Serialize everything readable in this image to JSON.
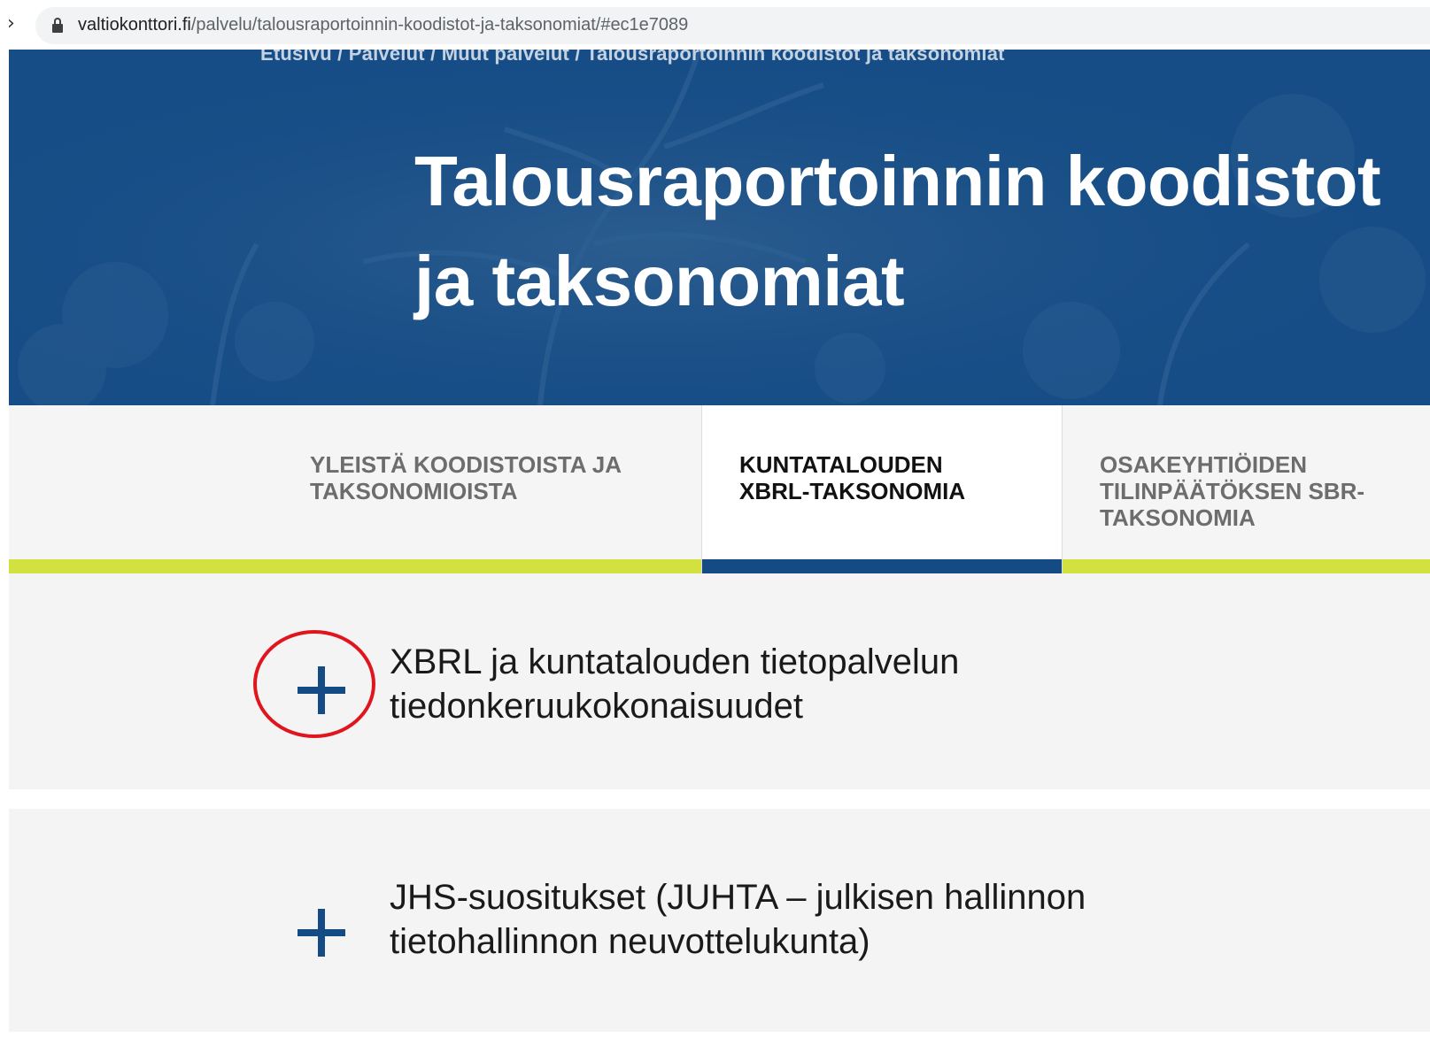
{
  "browser": {
    "url_domain": "valtiokonttori.fi",
    "url_path": "/palvelu/talousraportoinnin-koodistot-ja-taksonomiat/#ec1e7089"
  },
  "hero": {
    "breadcrumb": "Etusivu / Palvelut / Muut palvelut / Talousraportoinnin koodistot ja taksonomiat",
    "title": "Talousraportoinnin koodistot ja taksonomiat"
  },
  "tabs": [
    {
      "lines": [
        "YLEISTÄ KOODISTOISTA JA",
        "TAKSONOMIOISTA"
      ],
      "active": false
    },
    {
      "lines": [
        "KUNTATALOUDEN",
        "XBRL-TAKSONOMIA"
      ],
      "active": true
    },
    {
      "lines": [
        "OSAKEYHTIÖIDEN",
        "TILINPÄÄTÖKSEN SBR-",
        "TAKSONOMIA"
      ],
      "active": false
    }
  ],
  "accordion": [
    {
      "icon": "plus-icon",
      "lines": [
        "XBRL ja kuntatalouden tietopalvelun",
        "tiedonkeruukokonaisuudet"
      ],
      "highlighted": true
    },
    {
      "icon": "plus-icon",
      "lines": [
        "JHS-suositukset (JUHTA – julkisen hallinnon",
        "tietohallinnon neuvottelukunta)"
      ],
      "highlighted": false
    }
  ],
  "colors": {
    "brand_blue": "#144b85",
    "accent_lime": "#d3e140",
    "highlight_red": "#e0161e"
  }
}
